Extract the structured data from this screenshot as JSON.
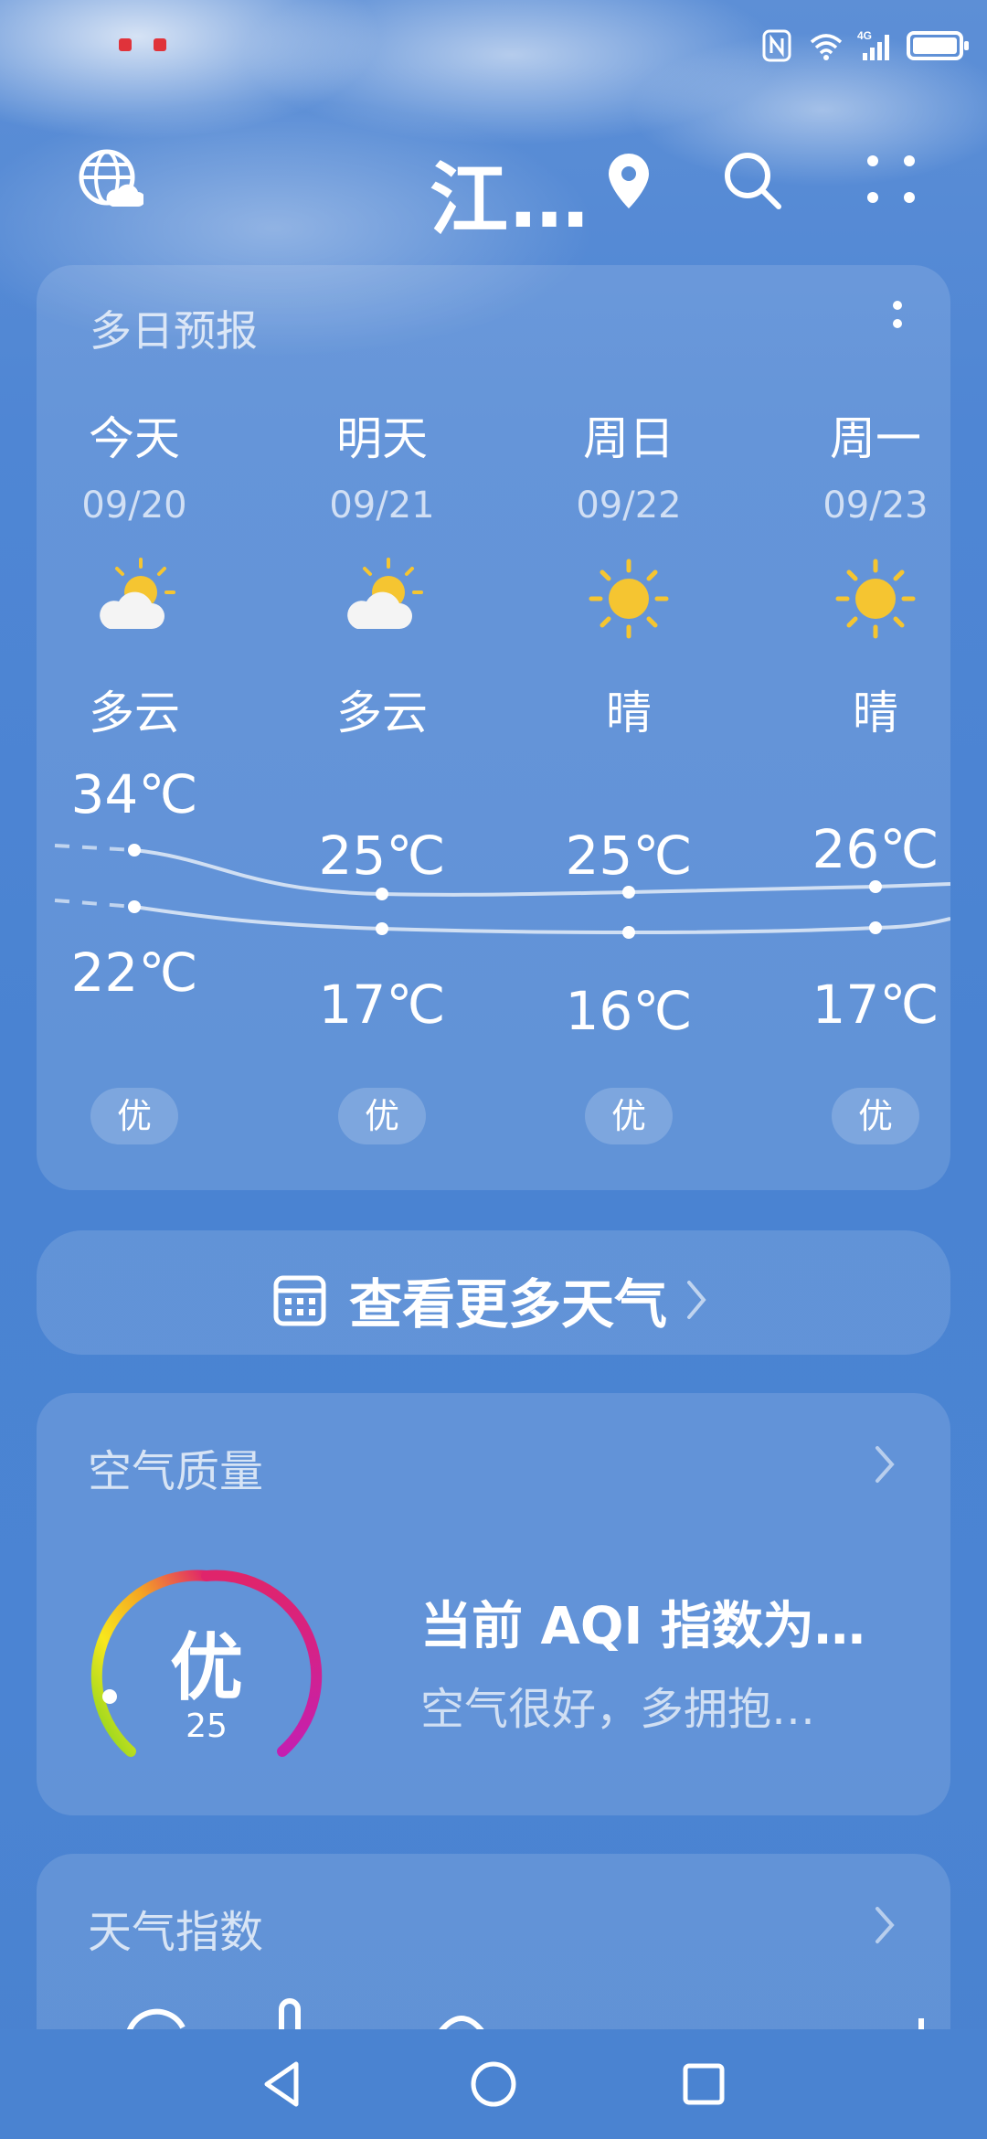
{
  "header": {
    "city": "江…"
  },
  "forecast": {
    "title": "多日预报",
    "days": [
      {
        "name": "今天",
        "date": "09/20",
        "condition": "多云",
        "icon": "partly-cloudy-icon",
        "high": "34℃",
        "low": "22℃",
        "aqi": "优"
      },
      {
        "name": "明天",
        "date": "09/21",
        "condition": "多云",
        "icon": "partly-cloudy-icon",
        "high": "25℃",
        "low": "17℃",
        "aqi": "优"
      },
      {
        "name": "周日",
        "date": "09/22",
        "condition": "晴",
        "icon": "sun-icon",
        "high": "25℃",
        "low": "16℃",
        "aqi": "优"
      },
      {
        "name": "周一",
        "date": "09/23",
        "condition": "晴",
        "icon": "sun-icon",
        "high": "26℃",
        "low": "17℃",
        "aqi": "优"
      }
    ]
  },
  "more_weather": {
    "label": "查看更多天气"
  },
  "air_quality": {
    "title": "空气质量",
    "level": "优",
    "value": "25",
    "aqi_line": "当前 AQI 指数为…",
    "tip": "空气很好，多拥抱…"
  },
  "weather_index": {
    "title": "天气指数"
  },
  "colors": {
    "background": "#4b84d3",
    "sun": "#f5c531",
    "gauge_start": "#7ed321",
    "gauge_mid": "#f5a623",
    "gauge_end": "#d0219b",
    "status_dot": "#e0333a"
  }
}
